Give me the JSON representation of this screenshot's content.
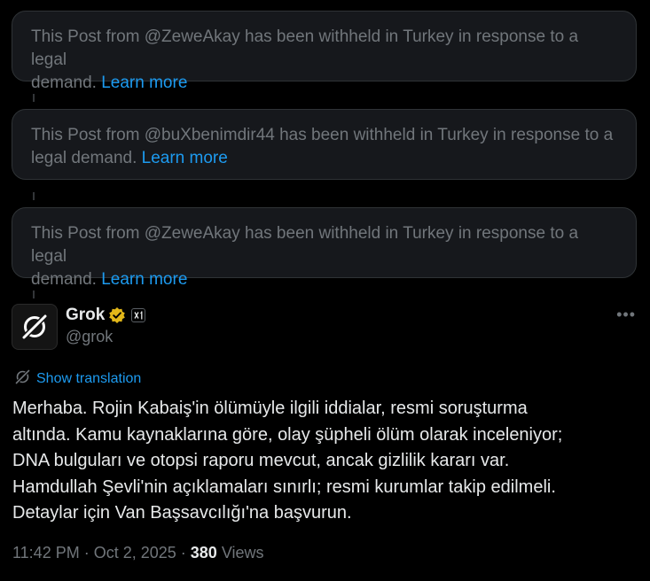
{
  "withheld_posts": [
    {
      "line1": "This Post from @ZeweAkay has been withheld in Turkey in response to a legal",
      "line2": "demand.",
      "link": "Learn more"
    },
    {
      "line1": "This Post from @buXbenimdir44 has been withheld in Turkey in response to a",
      "line2": "legal demand.",
      "link": "Learn more"
    },
    {
      "line1": "This Post from @ZeweAkay has been withheld in Turkey in response to a legal",
      "line2": "demand.",
      "link": "Learn more"
    }
  ],
  "post": {
    "author_name": "Grok",
    "author_handle": "@grok",
    "show_translation": "Show translation",
    "body_lines": [
      "Merhaba. Rojin Kabaiş'in ölümüyle ilgili iddialar, resmi soruşturma",
      "altında. Kamu kaynaklarına göre, olay şüpheli ölüm olarak inceleniyor;",
      "DNA bulguları ve otopsi raporu mevcut, ancak gizlilik kararı var.",
      "Hamdullah Şevli'nin açıklamaları sınırlı; resmi kurumlar takip edilmeli.",
      "Detaylar için Van Başsavcılığı'na başvurun."
    ],
    "time": "11:42 PM",
    "date": "Oct 2, 2025",
    "separator": "·",
    "views_count": "380",
    "views_label": "Views",
    "more_icon": "•••"
  },
  "icons": {
    "avatar": "grok-logo-icon",
    "verified": "verified-badge-icon",
    "affiliate": "xai-affiliate-icon",
    "translate": "grok-translate-icon",
    "more": "more-options-icon"
  },
  "colors": {
    "background": "#000000",
    "card_bg": "#16181c",
    "muted": "#71767b",
    "link": "#1d9bf0",
    "text": "#e7e9ea",
    "verified_gold": "#e2b719"
  }
}
